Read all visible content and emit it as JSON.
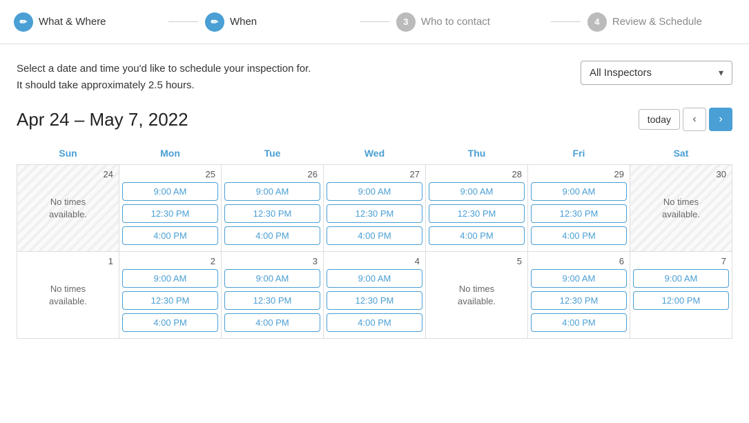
{
  "stepper": {
    "steps": [
      {
        "id": "what-where",
        "number": "✏",
        "label": "What & Where",
        "state": "active"
      },
      {
        "id": "when",
        "number": "✏",
        "label": "When",
        "state": "active"
      },
      {
        "id": "who-to-contact",
        "number": "3",
        "label": "Who to contact",
        "state": "inactive"
      },
      {
        "id": "review-schedule",
        "number": "4",
        "label": "Review & Schedule",
        "state": "inactive"
      }
    ]
  },
  "description": {
    "line1": "Select a date and time you'd like to schedule your inspection for.",
    "line2": "It should take approximately 2.5 hours."
  },
  "inspector_select": {
    "label": "All Inspectors",
    "chevron": "▾"
  },
  "date_range": {
    "title": "Apr 24 – May 7, 2022"
  },
  "nav": {
    "today_label": "today",
    "prev_label": "‹",
    "next_label": "›"
  },
  "calendar": {
    "headers": [
      "Sun",
      "Mon",
      "Tue",
      "Wed",
      "Thu",
      "Fri",
      "Sat"
    ],
    "weeks": [
      {
        "days": [
          {
            "date": 24,
            "shaded": true,
            "no_times": true,
            "times": []
          },
          {
            "date": 25,
            "shaded": false,
            "no_times": false,
            "times": [
              "9:00 AM",
              "12:30 PM",
              "4:00 PM"
            ]
          },
          {
            "date": 26,
            "shaded": false,
            "no_times": false,
            "times": [
              "9:00 AM",
              "12:30 PM",
              "4:00 PM"
            ]
          },
          {
            "date": 27,
            "shaded": false,
            "no_times": false,
            "times": [
              "9:00 AM",
              "12:30 PM",
              "4:00 PM"
            ]
          },
          {
            "date": 28,
            "shaded": false,
            "no_times": false,
            "times": [
              "9:00 AM",
              "12:30 PM",
              "4:00 PM"
            ]
          },
          {
            "date": 29,
            "shaded": false,
            "no_times": false,
            "times": [
              "9:00 AM",
              "12:30 PM",
              "4:00 PM"
            ]
          },
          {
            "date": 30,
            "shaded": true,
            "no_times": true,
            "times": []
          }
        ]
      },
      {
        "days": [
          {
            "date": 1,
            "shaded": false,
            "no_times": true,
            "times": []
          },
          {
            "date": 2,
            "shaded": false,
            "no_times": false,
            "times": [
              "9:00 AM",
              "12:30 PM",
              "4:00 PM"
            ]
          },
          {
            "date": 3,
            "shaded": false,
            "no_times": false,
            "times": [
              "9:00 AM",
              "12:30 PM",
              "4:00 PM"
            ]
          },
          {
            "date": 4,
            "shaded": false,
            "no_times": false,
            "times": [
              "9:00 AM",
              "12:30 PM",
              "4:00 PM"
            ]
          },
          {
            "date": 5,
            "shaded": false,
            "no_times": true,
            "times": []
          },
          {
            "date": 6,
            "shaded": false,
            "no_times": false,
            "times": [
              "9:00 AM",
              "12:30 PM",
              "4:00 PM"
            ]
          },
          {
            "date": 7,
            "shaded": false,
            "no_times": false,
            "times": [
              "9:00 AM",
              "12:00 PM"
            ]
          }
        ]
      }
    ],
    "no_times_text": "No times\navailable."
  }
}
